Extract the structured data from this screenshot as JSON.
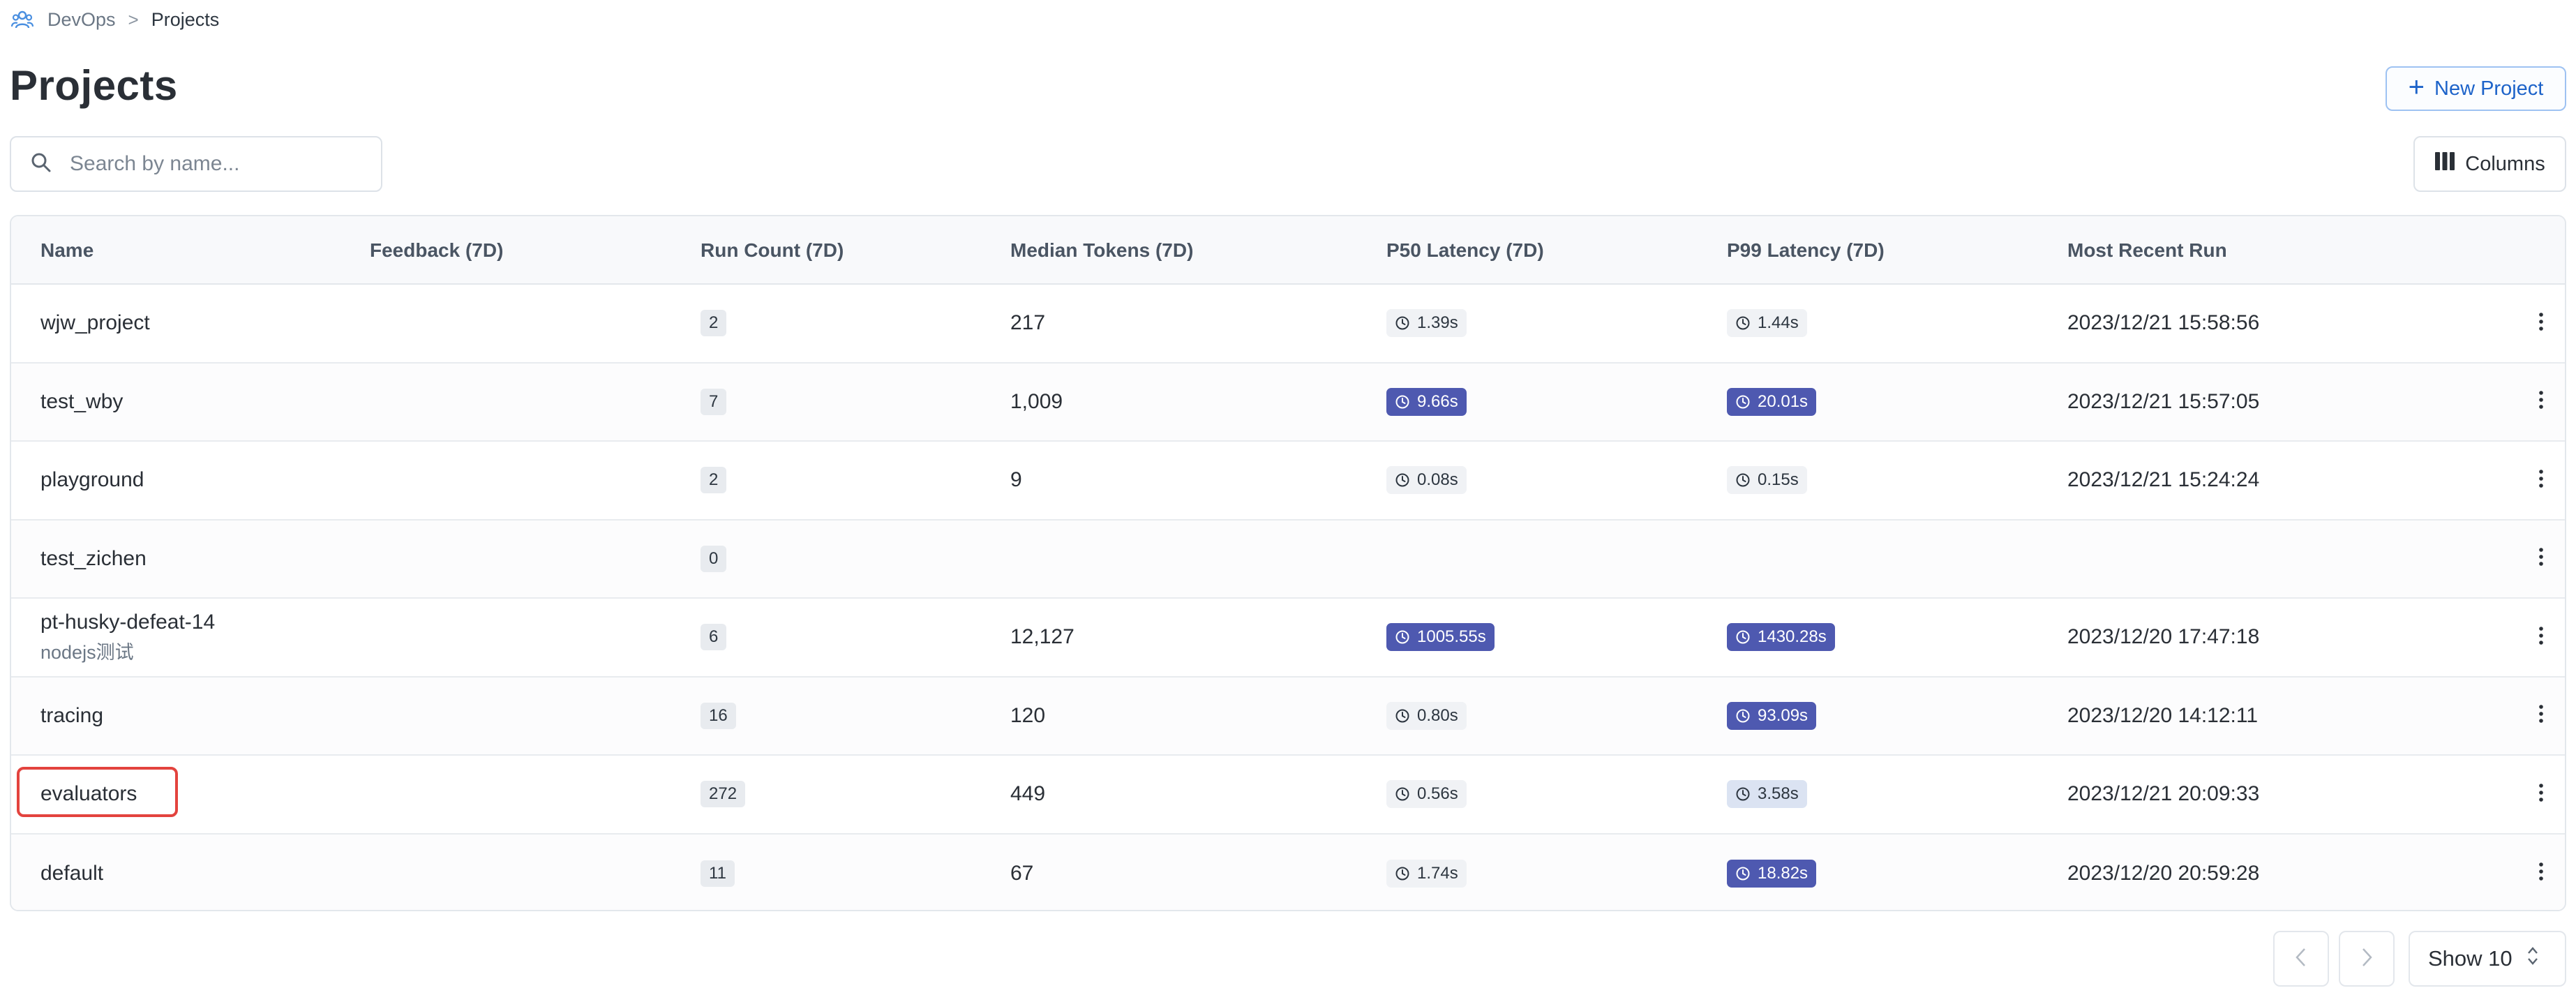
{
  "breadcrumb": {
    "root": "DevOps",
    "separator": ">",
    "current": "Projects"
  },
  "header": {
    "title": "Projects",
    "new_project_label": "New Project"
  },
  "search": {
    "placeholder": "Search by name..."
  },
  "toolbar": {
    "columns_label": "Columns"
  },
  "table": {
    "columns": [
      "Name",
      "Feedback (7D)",
      "Run Count (7D)",
      "Median Tokens (7D)",
      "P50 Latency (7D)",
      "P99 Latency (7D)",
      "Most Recent Run"
    ],
    "rows": [
      {
        "name": "wjw_project",
        "subname": "",
        "feedback": "",
        "run_count": "2",
        "median_tokens": "217",
        "p50": "1.39s",
        "p50_level": "low",
        "p99": "1.44s",
        "p99_level": "low",
        "recent": "2023/12/21 15:58:56"
      },
      {
        "name": "test_wby",
        "subname": "",
        "feedback": "",
        "run_count": "7",
        "median_tokens": "1,009",
        "p50": "9.66s",
        "p50_level": "high",
        "p99": "20.01s",
        "p99_level": "high",
        "recent": "2023/12/21 15:57:05"
      },
      {
        "name": "playground",
        "subname": "",
        "feedback": "",
        "run_count": "2",
        "median_tokens": "9",
        "p50": "0.08s",
        "p50_level": "low",
        "p99": "0.15s",
        "p99_level": "low",
        "recent": "2023/12/21 15:24:24"
      },
      {
        "name": "test_zichen",
        "subname": "",
        "feedback": "",
        "run_count": "0",
        "median_tokens": "",
        "p50": "",
        "p50_level": "none",
        "p99": "",
        "p99_level": "none",
        "recent": ""
      },
      {
        "name": "pt-husky-defeat-14",
        "subname": "nodejs测试",
        "feedback": "",
        "run_count": "6",
        "median_tokens": "12,127",
        "p50": "1005.55s",
        "p50_level": "high",
        "p99": "1430.28s",
        "p99_level": "high",
        "recent": "2023/12/20 17:47:18"
      },
      {
        "name": "tracing",
        "subname": "",
        "feedback": "",
        "run_count": "16",
        "median_tokens": "120",
        "p50": "0.80s",
        "p50_level": "low",
        "p99": "93.09s",
        "p99_level": "high",
        "recent": "2023/12/20 14:12:11"
      },
      {
        "name": "evaluators",
        "subname": "",
        "feedback": "",
        "run_count": "272",
        "median_tokens": "449",
        "p50": "0.56s",
        "p50_level": "low",
        "p99": "3.58s",
        "p99_level": "mid",
        "recent": "2023/12/21 20:09:33"
      },
      {
        "name": "default",
        "subname": "",
        "feedback": "",
        "run_count": "11",
        "median_tokens": "67",
        "p50": "1.74s",
        "p50_level": "low",
        "p99": "18.82s",
        "p99_level": "high",
        "recent": "2023/12/20 20:59:28"
      }
    ]
  },
  "pagination": {
    "show_label": "Show 10"
  },
  "colors": {
    "accent": "#1d63c9",
    "latency_high": "#4e59b0",
    "latency_mid": "#dbe3f2",
    "highlight": "#e3433e"
  },
  "icons": {
    "breadcrumb": "people-icon",
    "search": "search-icon",
    "columns": "columns-icon",
    "add": "plus-icon",
    "latency": "clock-icon",
    "row_menu": "more-vertical-icon"
  }
}
